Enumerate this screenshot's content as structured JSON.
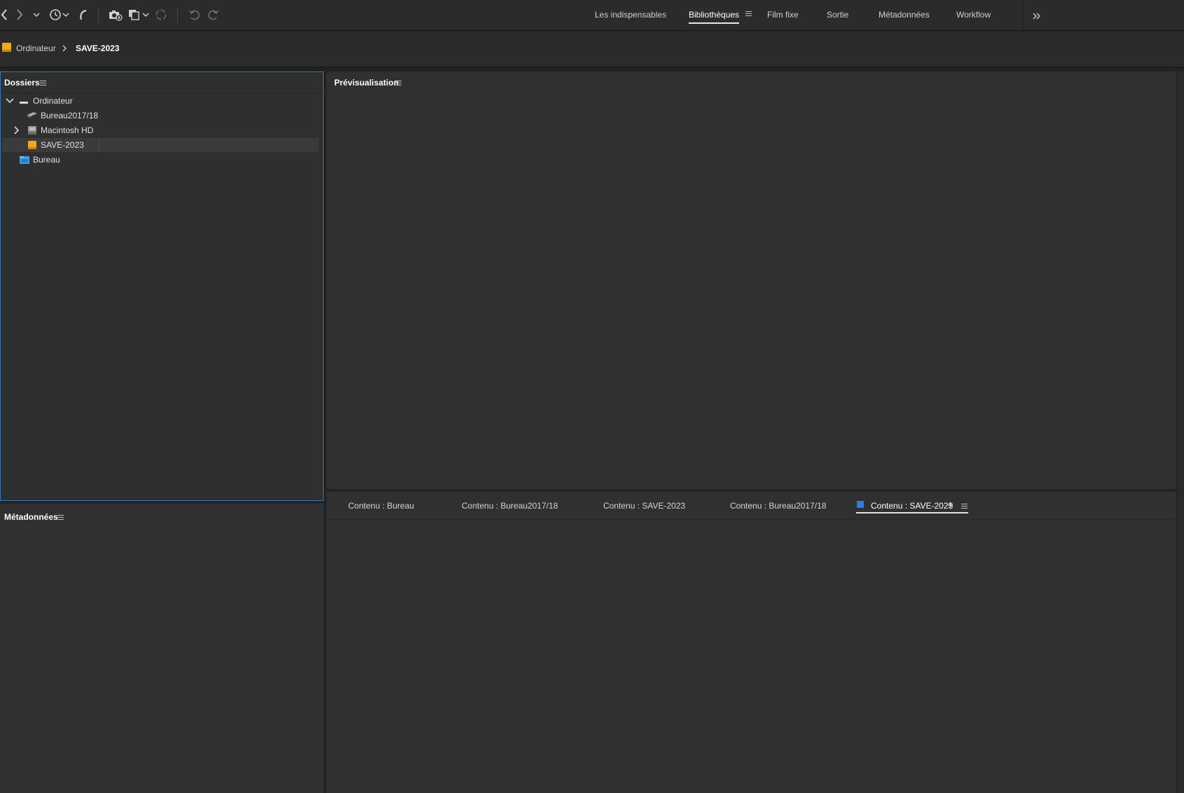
{
  "toolbar": {
    "workspaces": [
      {
        "label": "Les indispensables",
        "active": false
      },
      {
        "label": "Bibliothèques",
        "active": true
      },
      {
        "label": "Film fixe",
        "active": false
      },
      {
        "label": "Sortie",
        "active": false
      },
      {
        "label": "Métadonnées",
        "active": false
      },
      {
        "label": "Workflow",
        "active": false
      }
    ],
    "overflow_icon": "double-chevron-right-icon"
  },
  "path_bar": {
    "crumbs": [
      "Ordinateur",
      "SAVE-2023"
    ]
  },
  "folders_panel": {
    "title": "Dossiers",
    "tree": [
      {
        "label": "Ordinateur",
        "icon": "computer-icon",
        "expanded": true
      },
      {
        "label": "Bureau2017/18",
        "icon": "network-drive-icon"
      },
      {
        "label": "Macintosh HD",
        "icon": "hard-drive-icon",
        "expanded": false
      },
      {
        "label": "SAVE-2023",
        "icon": "external-drive-icon",
        "selected": true
      },
      {
        "label": "Bureau",
        "icon": "desktop-folder-icon"
      }
    ]
  },
  "metadata_panel": {
    "title": "Métadonnées"
  },
  "preview_panel": {
    "title": "Prévisualisation"
  },
  "content_panel": {
    "tabs": [
      {
        "label": "Contenu : Bureau",
        "active": false
      },
      {
        "label": "Contenu : Bureau2017/18",
        "active": false
      },
      {
        "label": "Contenu : SAVE-2023",
        "active": false
      },
      {
        "label": "Contenu : Bureau2017/18",
        "active": false
      },
      {
        "label": "Contenu : SAVE-2023",
        "active": true
      }
    ],
    "add_tab_label": "+"
  },
  "colors": {
    "accent_blue": "#2d7be5",
    "drive_orange": "#f0a81c",
    "panel_bg": "#303030",
    "focus_border": "#3d74c0"
  }
}
